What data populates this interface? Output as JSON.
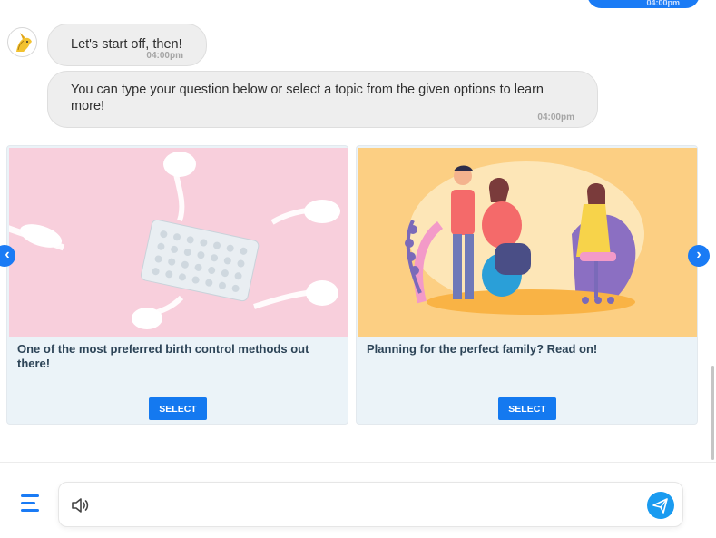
{
  "user_bubble": {
    "time": "04:00pm"
  },
  "messages": [
    {
      "text": "Let's start off, then!",
      "time": "04:00pm"
    },
    {
      "text": "You can type your question below or select a topic from the given options to learn more!",
      "time": "04:00pm"
    }
  ],
  "cards": [
    {
      "title": "One of the most preferred birth control methods out there!",
      "button": "SELECT"
    },
    {
      "title": "Planning for the perfect family? Read on!",
      "button": "SELECT"
    }
  ],
  "carousel": {
    "prev_icon": "chevron-left-icon",
    "next_icon": "chevron-right-icon",
    "prev_glyph": "‹",
    "next_glyph": "›"
  },
  "composer": {
    "placeholder": "",
    "value": ""
  },
  "colors": {
    "accent": "#1a7bf5",
    "bubble": "#eeeeee",
    "card_bg": "#ebf3f8",
    "title": "#2d4457"
  }
}
